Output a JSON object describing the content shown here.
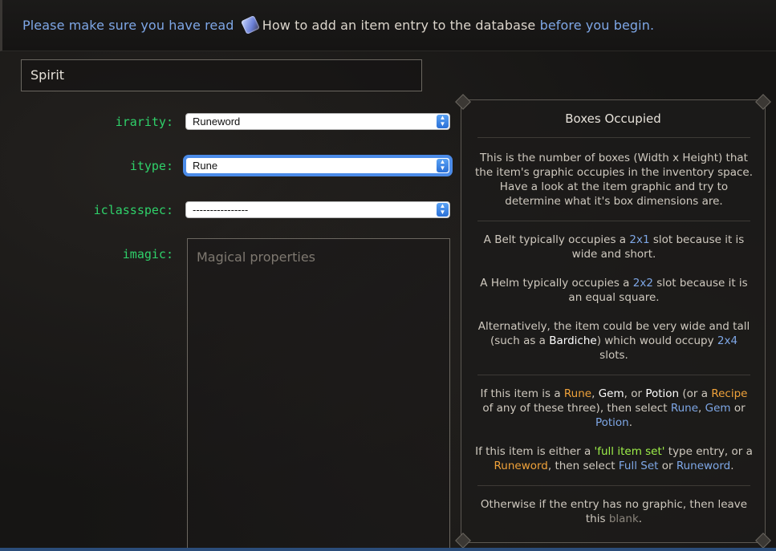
{
  "notice": {
    "prefix": "Please make sure you have read",
    "icon": "scroll-icon",
    "guide": "How to add an item entry to the database",
    "suffix": "before you begin."
  },
  "name_field": {
    "value": "Spirit"
  },
  "fields": {
    "irarity": {
      "label": "irarity:",
      "value": "Runeword"
    },
    "itype": {
      "label": "itype:",
      "value": "Rune"
    },
    "iclassspec": {
      "label": "iclassspec:",
      "value": "----------------"
    },
    "imagic": {
      "label": "imagic:",
      "placeholder": "Magical properties"
    }
  },
  "panel": {
    "title": "Boxes Occupied",
    "intro": "This is the number of boxes (Width x Height) that the item's graphic occupies in the inventory space. Have a look at the item graphic and try to determine what it's box dimensions are.",
    "belt": {
      "a": "A Belt typically occupies a ",
      "size": "2x1",
      "b": " slot because it is wide and short."
    },
    "helm": {
      "a": "A Helm typically occupies a ",
      "size": "2x2",
      "b": " slot because it is an equal square."
    },
    "alt": {
      "a": "Alternatively, the item could be very wide and tall (such as a ",
      "item": "Bardiche",
      "b": ") which would occupy ",
      "size": "2x4",
      "c": " slots."
    },
    "rune": {
      "a": "If this item is a ",
      "rune": "Rune",
      "b": ", ",
      "gem": "Gem",
      "c": ", or ",
      "potion": "Potion",
      "d": " (or a ",
      "recipe": "Recipe",
      "e": " of any of these three), then select ",
      "rune_link": "Rune",
      "f": ", ",
      "gem_link": "Gem",
      "g": " or ",
      "potion_link": "Potion",
      "h": "."
    },
    "set": {
      "a": "If this item is either a ",
      "full_item_set": "'full item set'",
      "b": " type entry, or a ",
      "runeword": "Runeword",
      "c": ", then select ",
      "full_set_link": "Full Set",
      "d": " or ",
      "runeword_link": "Runeword",
      "e": "."
    },
    "blank": {
      "a": "Otherwise if the entry has no graphic, then leave this ",
      "blank": "blank",
      "b": "."
    }
  }
}
